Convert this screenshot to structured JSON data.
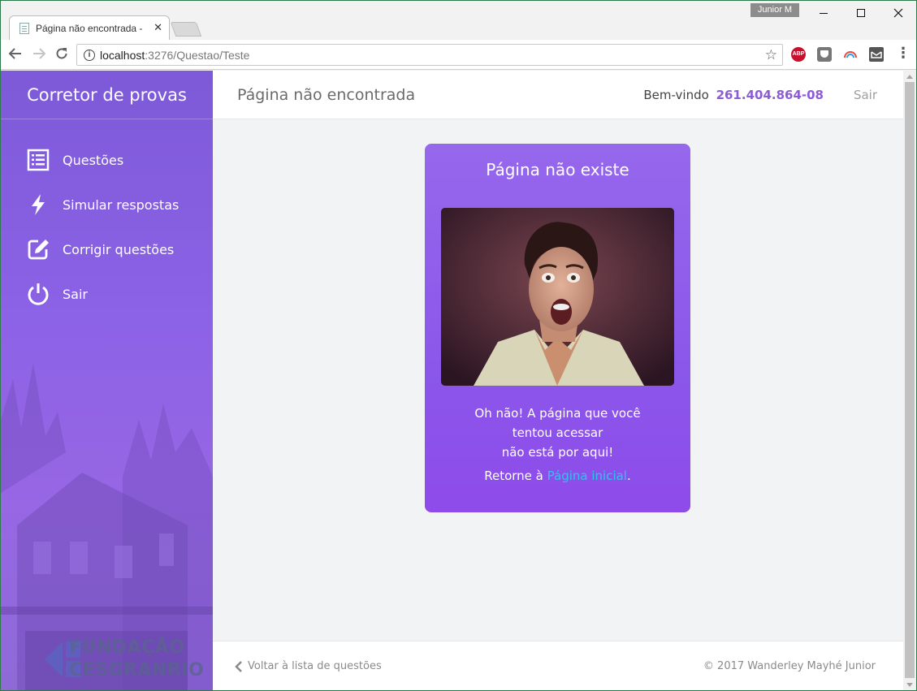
{
  "browser": {
    "tab_title": "Página não encontrada -",
    "tab_close": "✕",
    "profile_name": "Junior M",
    "url_host": "localhost",
    "url_path": ":3276/Questao/Teste",
    "abp_label": "ABP",
    "menu_icon": "⋮"
  },
  "sidebar": {
    "brand": "Corretor de provas",
    "items": [
      {
        "label": "Questões",
        "icon": "list-icon"
      },
      {
        "label": "Simular respostas",
        "icon": "lightning-icon"
      },
      {
        "label": "Corrigir questões",
        "icon": "edit-icon"
      },
      {
        "label": "Sair",
        "icon": "power-icon"
      }
    ],
    "logo_line1": "FUNDAÇÃO",
    "logo_line2": "CESGRANRIO"
  },
  "header": {
    "title": "Página não encontrada",
    "welcome_label": "Bem-vindo",
    "user_id": "261.404.864-08",
    "logout": "Sair"
  },
  "card": {
    "title": "Página não existe",
    "message_line1": "Oh não! A página que você",
    "message_line2": "tentou acessar",
    "message_line3": "não está por aqui!",
    "return_prefix": "Retorne à ",
    "home_link": "Página inicial",
    "return_suffix": "."
  },
  "footer": {
    "back_link": "Voltar à lista de questões",
    "copyright": "© 2017 Wanderley Mayhé Junior"
  },
  "colors": {
    "accent": "#8b5cd6",
    "card_bg": "#9166ea",
    "link": "#2fc3f0"
  }
}
